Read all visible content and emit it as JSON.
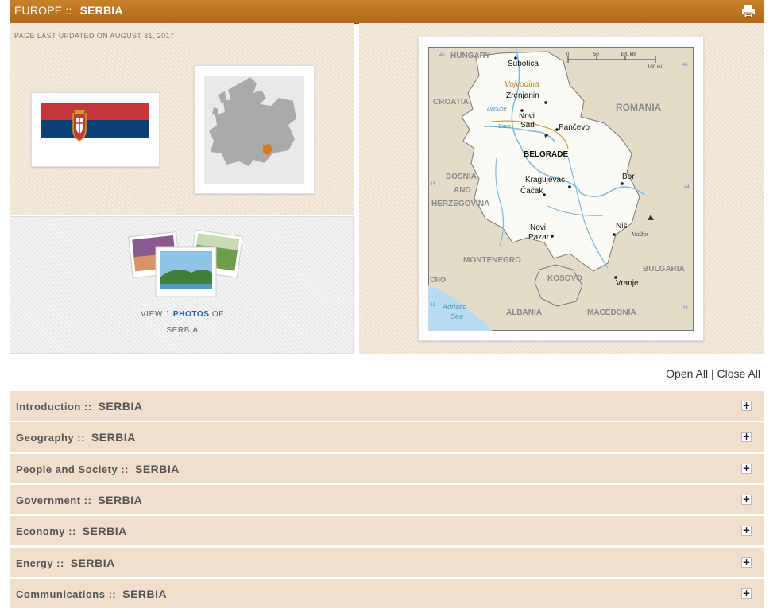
{
  "header": {
    "region": "EUROPE ::",
    "country": "SERBIA",
    "print_icon": "printer-icon"
  },
  "summary": {
    "updated": "PAGE LAST UPDATED ON AUGUST 31, 2017",
    "photos": {
      "prefix": "VIEW 1",
      "link": "PHOTOS",
      "suffix": "OF",
      "country": "SERBIA"
    }
  },
  "map": {
    "labels": {
      "hungary": "HUNGARY",
      "croatia": "CROATIA",
      "romania": "ROMANIA",
      "bosnia1": "BOSNIA",
      "bosnia2": "AND",
      "bosnia3": "HERZEGOVINA",
      "montenegro": "MONTENEGRO",
      "kosovo": "KOSOVO",
      "albania": "ALBANIA",
      "macedonia": "MACEDONIA",
      "bulgaria": "BULGARIA",
      "vojvodina": "Vojvodina",
      "danube": "Danube",
      "sava": "Sava",
      "adriatic1": "Adriatic",
      "adriatic2": "Sea",
      "subotica": "Subotica",
      "zrenjanin": "Zrenjanin",
      "novi_sad1": "Novi",
      "novi_sad2": "Sad",
      "pancevo": "Pančevo",
      "belgrade": "BELGRADE",
      "kragujevac": "Kragujevac",
      "cacak": "Čačak",
      "bor": "Bor",
      "nis": "Niš",
      "novi_pazar1": "Novi",
      "novi_pazar2": "Pazar",
      "vranje": "Vranje",
      "midzor": "Midžor",
      "cro": "CRO",
      "scale_km": "100 km",
      "scale_mi": "100 mi",
      "scale_0": "0",
      "scale_50": "50"
    }
  },
  "controls": {
    "open_all": "Open All",
    "separator": "|",
    "close_all": "Close All"
  },
  "sections": [
    {
      "label": "Introduction ::",
      "country": "SERBIA"
    },
    {
      "label": "Geography ::",
      "country": "SERBIA"
    },
    {
      "label": "People and Society ::",
      "country": "SERBIA"
    },
    {
      "label": "Government ::",
      "country": "SERBIA"
    },
    {
      "label": "Economy ::",
      "country": "SERBIA"
    },
    {
      "label": "Energy ::",
      "country": "SERBIA"
    },
    {
      "label": "Communications ::",
      "country": "SERBIA"
    }
  ],
  "colors": {
    "header_bar": "#b87320",
    "panel_bg": "#f2e6d6",
    "accordion_bg": "#f1dfcd",
    "link_blue": "#1f5fa7"
  }
}
